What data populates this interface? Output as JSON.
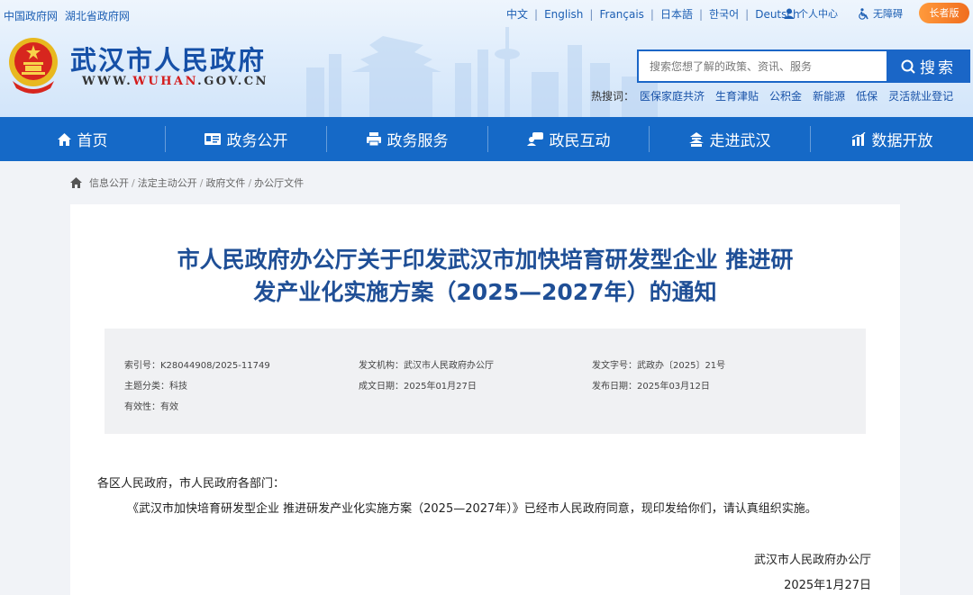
{
  "header": {
    "top_links": [
      "中国政府网",
      "湖北省政府网"
    ],
    "languages": [
      "中文",
      "English",
      "Français",
      "日本語",
      "한국어",
      "Deutsch"
    ],
    "user_center": "个人中心",
    "accessibility": "无障碍",
    "elder_version": "长者版",
    "site_name": "武汉市人民政府",
    "site_url_prefix": "WWW.",
    "site_url_domain": "WUHAN",
    "site_url_suffix": ".GOV.CN",
    "search": {
      "placeholder": "搜索您想了解的政策、资讯、服务",
      "button_label": "搜索"
    },
    "hot_search_label": "热搜词：",
    "hot_terms": [
      "医保家庭共济",
      "生育津贴",
      "公积金",
      "新能源",
      "低保",
      "灵活就业登记"
    ]
  },
  "nav": {
    "items": [
      {
        "label": "首页",
        "icon": "home-icon"
      },
      {
        "label": "政务公开",
        "icon": "id-card-icon"
      },
      {
        "label": "政务服务",
        "icon": "printer-icon"
      },
      {
        "label": "政民互动",
        "icon": "chat-user-icon"
      },
      {
        "label": "走进武汉",
        "icon": "pavilion-icon"
      },
      {
        "label": "数据开放",
        "icon": "bar-chart-icon"
      }
    ]
  },
  "breadcrumb": [
    "信息公开",
    "法定主动公开",
    "政府文件",
    "办公厅文件"
  ],
  "article": {
    "title_line1": "市人民政府办公厅关于印发武汉市加快培育研发型企业 推进研",
    "title_line2": "发产业化实施方案（2025—2027年）的通知",
    "meta": {
      "index_label": "索引号：",
      "index_value": "K28044908/2025-11749",
      "issuer_label": "发文机构：",
      "issuer_value": "武汉市人民政府办公厅",
      "docno_label": "发文字号：",
      "docno_value": "武政办〔2025〕21号",
      "topic_label": "主题分类：",
      "topic_value": "科技",
      "written_label": "成文日期：",
      "written_value": "2025年01月27日",
      "publish_label": "发布日期：",
      "publish_value": "2025年03月12日",
      "valid_label": "有效性：",
      "valid_value": "有效"
    },
    "salutation": "各区人民政府，市人民政府各部门：",
    "paragraph": "《武汉市加快培育研发型企业 推进研发产业化实施方案（2025—2027年）》已经市人民政府同意，现印发给你们，请认真组织实施。",
    "signature": "武汉市人民政府办公厅",
    "date": "2025年1月27日"
  },
  "colors": {
    "nav_bg": "#1569c7",
    "title": "#1f4f96",
    "link": "#1650a7",
    "elder_btn": "#f06d1e"
  }
}
